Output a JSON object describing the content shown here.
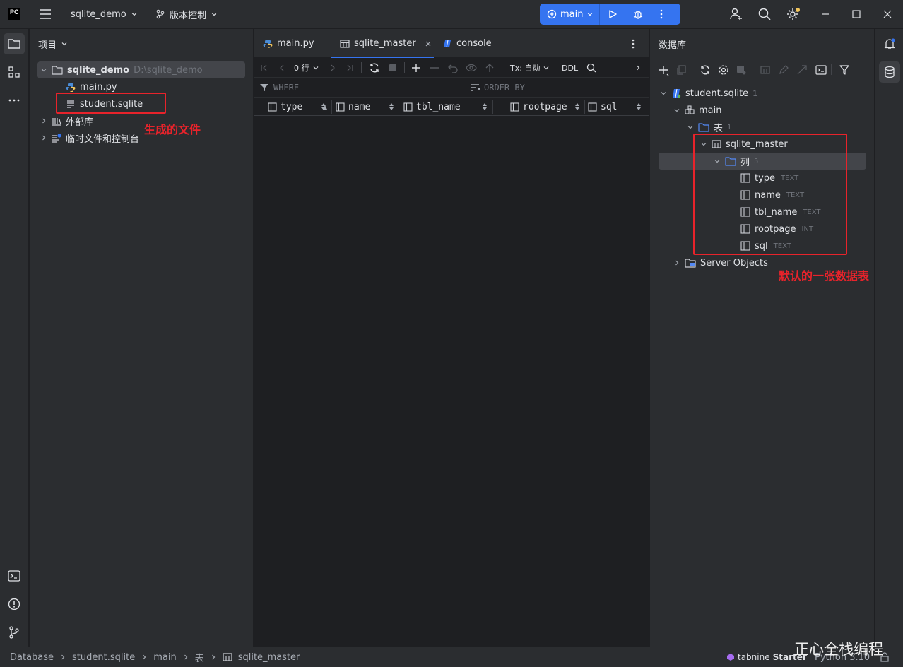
{
  "titlebar": {
    "logo": "PC",
    "project_name": "sqlite_demo",
    "vcs_label": "版本控制",
    "run_config": "main",
    "icons": [
      "hamburger-menu-icon",
      "branch-icon",
      "python-run-config-icon",
      "play-icon",
      "debug-bug-icon",
      "more-vertical-icon",
      "add-user-icon",
      "search-icon",
      "settings-gear-icon",
      "minimize-icon",
      "maximize-icon",
      "close-icon"
    ]
  },
  "project_panel": {
    "title": "项目",
    "root": {
      "name": "sqlite_demo",
      "path": "D:\\sqlite_demo"
    },
    "files": [
      "main.py",
      "student.sqlite"
    ],
    "external_libs": "外部库",
    "scratches": "临时文件和控制台"
  },
  "editor": {
    "tabs": [
      {
        "label": "main.py"
      },
      {
        "label": "sqlite_master"
      },
      {
        "label": "console"
      }
    ],
    "toolbar": {
      "rows": "0 行",
      "tx": "Tx: 自动",
      "ddl": "DDL"
    },
    "filter": {
      "where": "WHERE",
      "order_by": "ORDER BY"
    },
    "columns": [
      "type",
      "name",
      "tbl_name",
      "rootpage",
      "sql"
    ]
  },
  "db_panel": {
    "title": "数据库",
    "datasource": {
      "name": "student.sqlite",
      "count": "1"
    },
    "schema": "main",
    "tables_folder": {
      "name": "表",
      "count": "1"
    },
    "table": "sqlite_master",
    "columns_folder": {
      "name": "列",
      "count": "5"
    },
    "columns": [
      {
        "name": "type",
        "type": "TEXT"
      },
      {
        "name": "name",
        "type": "TEXT"
      },
      {
        "name": "tbl_name",
        "type": "TEXT"
      },
      {
        "name": "rootpage",
        "type": "INT"
      },
      {
        "name": "sql",
        "type": "TEXT"
      }
    ],
    "server_objects": "Server Objects"
  },
  "annotations": {
    "generated_file": "生成的文件",
    "default_table": "默认的一张数据表"
  },
  "statusbar": {
    "breadcrumb": [
      "Database",
      "student.sqlite",
      "main",
      "表",
      "sqlite_master"
    ],
    "tabnine": "tabnine",
    "tabnine_plan": "Starter",
    "python": "Python 3.10",
    "watermark": "正心全栈编程"
  },
  "colors": {
    "accent": "#3574f0",
    "annotation_red": "#e8232b",
    "panel_bg": "#2b2d30",
    "editor_bg": "#1e1f22"
  }
}
